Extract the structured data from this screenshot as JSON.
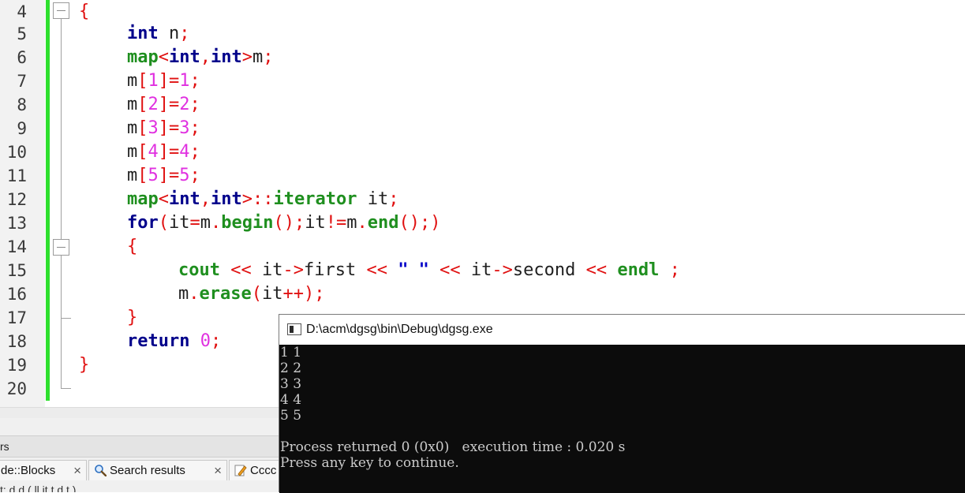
{
  "editor": {
    "line_numbers": [
      "4",
      "5",
      "6",
      "7",
      "8",
      "9",
      "10",
      "11",
      "12",
      "13",
      "14",
      "15",
      "16",
      "17",
      "18",
      "19",
      "20"
    ],
    "code": {
      "l4_open": "{",
      "l5_kw": "int",
      "l5_rest": " n",
      "l5_semi": ";",
      "l6_map": "map",
      "l6_lt": "<",
      "l6_int1": "int",
      "l6_comma": ",",
      "l6_int2": "int",
      "l6_gt": ">",
      "l6_m": "m",
      "l6_semi": ";",
      "lines_assign": [
        {
          "var": "m",
          "lb": "[",
          "idx": "1",
          "rb": "]",
          "eq": "=",
          "val": "1",
          "semi": ";"
        },
        {
          "var": "m",
          "lb": "[",
          "idx": "2",
          "rb": "]",
          "eq": "=",
          "val": "2",
          "semi": ";"
        },
        {
          "var": "m",
          "lb": "[",
          "idx": "3",
          "rb": "]",
          "eq": "=",
          "val": "3",
          "semi": ";"
        },
        {
          "var": "m",
          "lb": "[",
          "idx": "4",
          "rb": "]",
          "eq": "=",
          "val": "4",
          "semi": ";"
        },
        {
          "var": "m",
          "lb": "[",
          "idx": "5",
          "rb": "]",
          "eq": "=",
          "val": "5",
          "semi": ";"
        }
      ],
      "l12_map": "map",
      "l12_lt": "<",
      "l12_int1": "int",
      "l12_comma": ",",
      "l12_int2": "int",
      "l12_gt": ">::",
      "l12_iter": "iterator",
      "l12_it": " it",
      "l12_semi": ";",
      "l13_for": "for",
      "l13_p1": "(",
      "l13_it1": "it",
      "l13_eq": "=",
      "l13_m1": "m",
      "l13_dot1": ".",
      "l13_begin": "begin",
      "l13_p2": "();",
      "l13_it2": "it",
      "l13_ne": "!=",
      "l13_m2": "m",
      "l13_dot2": ".",
      "l13_end": "end",
      "l13_p3": "();)",
      "l14_open": "{",
      "l15_cout": "cout",
      "l15_sh1": " << ",
      "l15_it1": "it",
      "l15_arrow1": "->",
      "l15_first": "first",
      "l15_sh2": " << ",
      "l15_str": "\" \"",
      "l15_sh3": " << ",
      "l15_it2": "it",
      "l15_arrow2": "->",
      "l15_second": "second",
      "l15_sh4": " << ",
      "l15_endl": "endl",
      "l15_semi": " ;",
      "l16_m": "m",
      "l16_dot": ".",
      "l16_erase": "erase",
      "l16_p1": "(",
      "l16_it": "it",
      "l16_pp": "++);",
      "l17_close": "}",
      "l18_ret": "return",
      "l18_zero": "0",
      "l18_semi": ";",
      "l19_close": "}"
    }
  },
  "logs_panel": {
    "title": "rs",
    "tabs": [
      {
        "label": "de::Blocks",
        "close": "×"
      },
      {
        "label": "Search results",
        "close": "×"
      },
      {
        "label": "Cccc",
        "close": ""
      }
    ],
    "content": "t: d   d    (  ll it      t   d  t  )"
  },
  "console": {
    "title": "D:\\acm\\dgsg\\bin\\Debug\\dgsg.exe",
    "lines": [
      "1 1",
      "2 2",
      "3 3",
      "4 4",
      "5 5",
      "",
      "Process returned 0 (0x0)   execution time : 0.020 s",
      "Press any key to continue."
    ]
  },
  "colors": {
    "keyword": "#00008b",
    "type": "#1f8f1f",
    "operator": "#e01010",
    "number": "#e030e0",
    "changebar": "#2ee02e",
    "console_bg": "#0c0c0c"
  }
}
